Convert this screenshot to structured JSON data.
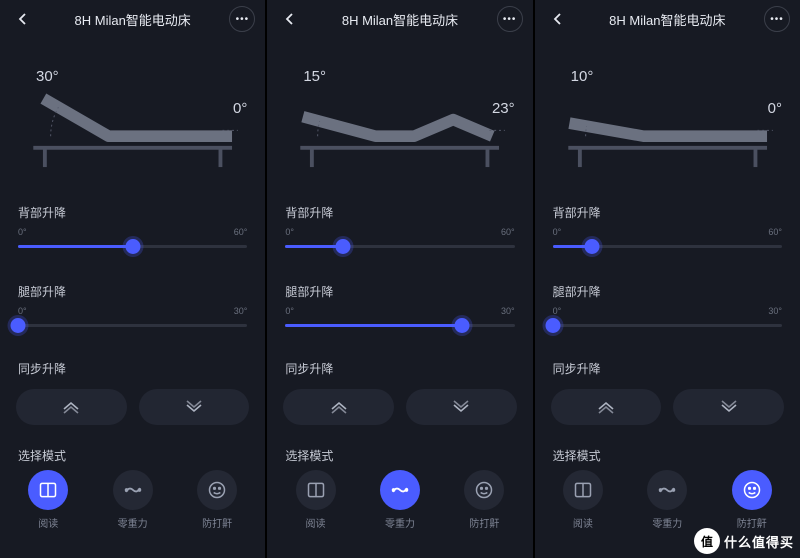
{
  "screens": [
    {
      "title": "8H Milan智能电动床",
      "back_angle": "30°",
      "leg_angle": "0°",
      "sliders": {
        "back": {
          "label": "背部升降",
          "min": "0°",
          "max": "60°",
          "pct": 50
        },
        "leg": {
          "label": "腿部升降",
          "min": "0°",
          "max": "30°",
          "pct": 0
        }
      },
      "sync_label": "同步升降",
      "modes_label": "选择模式",
      "modes": [
        {
          "key": "reading",
          "label": "阅读",
          "active": true
        },
        {
          "key": "zerog",
          "label": "零重力",
          "active": false
        },
        {
          "key": "antisnore",
          "label": "防打鼾",
          "active": false
        }
      ],
      "bed_geom": {
        "back_deg": 30,
        "leg_deg": 0
      }
    },
    {
      "title": "8H Milan智能电动床",
      "back_angle": "15°",
      "leg_angle": "23°",
      "sliders": {
        "back": {
          "label": "背部升降",
          "min": "0°",
          "max": "60°",
          "pct": 25
        },
        "leg": {
          "label": "腿部升降",
          "min": "0°",
          "max": "30°",
          "pct": 77
        }
      },
      "sync_label": "同步升降",
      "modes_label": "选择模式",
      "modes": [
        {
          "key": "reading",
          "label": "阅读",
          "active": false
        },
        {
          "key": "zerog",
          "label": "零重力",
          "active": true
        },
        {
          "key": "antisnore",
          "label": "防打鼾",
          "active": false
        }
      ],
      "bed_geom": {
        "back_deg": 15,
        "leg_deg": 23
      }
    },
    {
      "title": "8H Milan智能电动床",
      "back_angle": "10°",
      "leg_angle": "0°",
      "sliders": {
        "back": {
          "label": "背部升降",
          "min": "0°",
          "max": "60°",
          "pct": 17
        },
        "leg": {
          "label": "腿部升降",
          "min": "0°",
          "max": "30°",
          "pct": 0
        }
      },
      "sync_label": "同步升降",
      "modes_label": "选择模式",
      "modes": [
        {
          "key": "reading",
          "label": "阅读",
          "active": false
        },
        {
          "key": "zerog",
          "label": "零重力",
          "active": false
        },
        {
          "key": "antisnore",
          "label": "防打鼾",
          "active": true
        }
      ],
      "bed_geom": {
        "back_deg": 10,
        "leg_deg": 0
      }
    }
  ],
  "watermark": {
    "badge": "值",
    "text": "什么值得买"
  }
}
